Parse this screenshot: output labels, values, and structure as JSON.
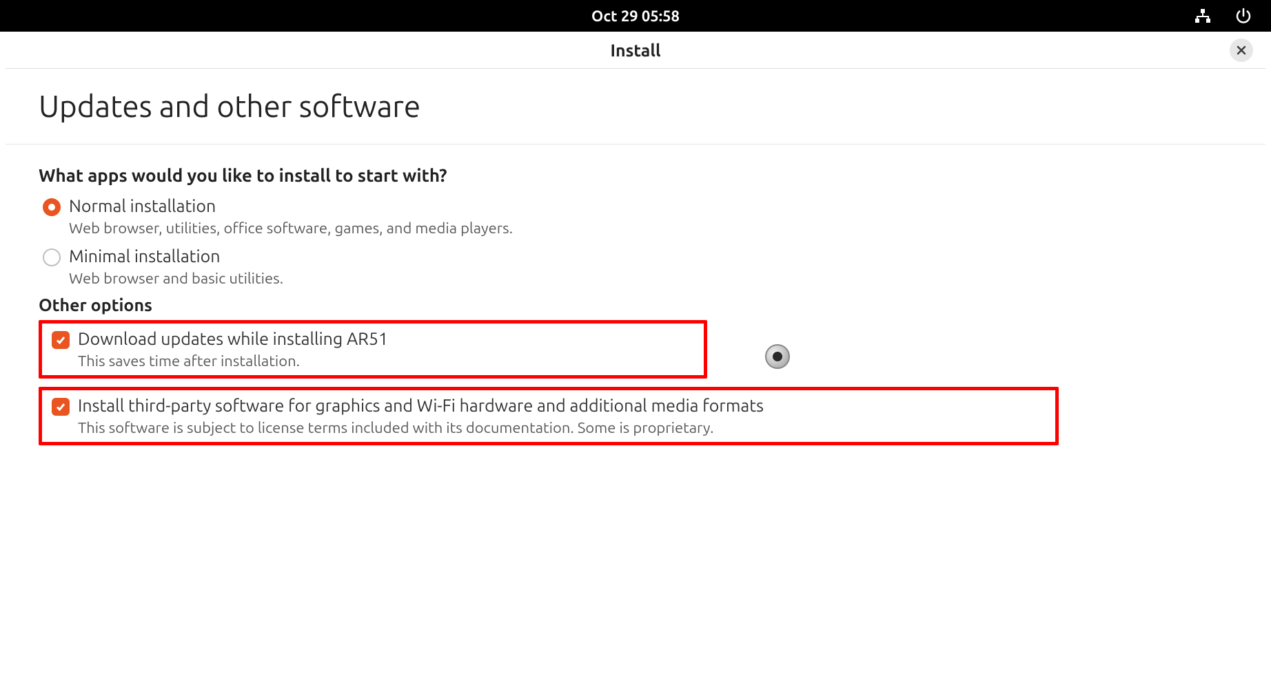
{
  "topbar": {
    "datetime": "Oct 29  05:58"
  },
  "window": {
    "title": "Install"
  },
  "page": {
    "title": "Updates and other software",
    "subtitle": "What apps would you like to install to start with?"
  },
  "install_type": {
    "normal": {
      "label": "Normal installation",
      "desc": "Web browser, utilities, office software, games, and media players.",
      "selected": true
    },
    "minimal": {
      "label": "Minimal installation",
      "desc": "Web browser and basic utilities.",
      "selected": false
    }
  },
  "other_options": {
    "header": "Other options",
    "download_updates": {
      "label": "Download updates while installing AR51",
      "desc": "This saves time after installation.",
      "checked": true
    },
    "third_party": {
      "label": "Install third-party software for graphics and Wi-Fi hardware and additional media formats",
      "desc": "This software is subject to license terms included with its documentation. Some is proprietary.",
      "checked": true
    }
  }
}
